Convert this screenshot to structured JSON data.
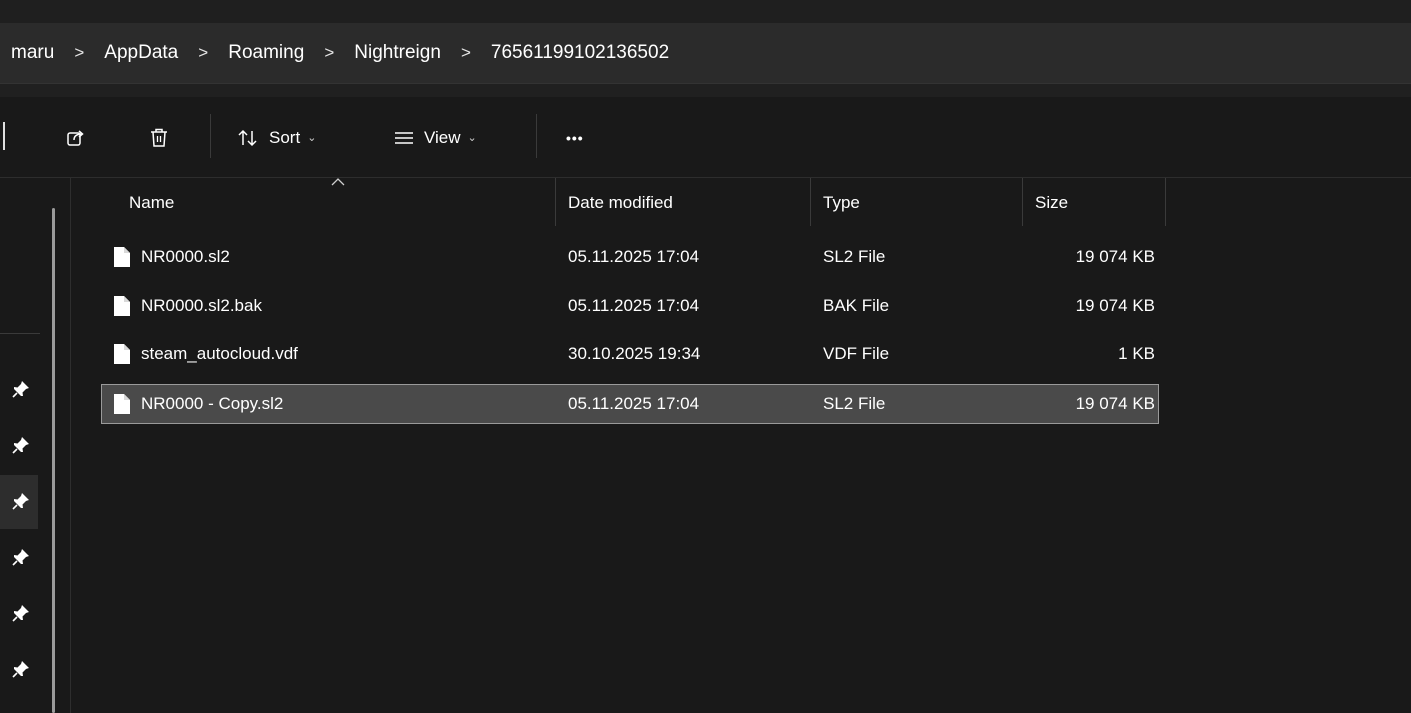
{
  "breadcrumb": {
    "items": [
      "maru",
      "AppData",
      "Roaming",
      "Nightreign",
      "76561199102136502"
    ],
    "separator": ">"
  },
  "toolbar": {
    "share_icon": "share-icon",
    "delete_icon": "trash-icon",
    "sort_label": "Sort",
    "view_label": "View",
    "more_label": "•••"
  },
  "columns": {
    "name": "Name",
    "date": "Date modified",
    "type": "Type",
    "size": "Size"
  },
  "files": [
    {
      "name": "NR0000.sl2",
      "date": "05.11.2025 17:04",
      "type": "SL2 File",
      "size": "19 074 KB"
    },
    {
      "name": "NR0000.sl2.bak",
      "date": "05.11.2025 17:04",
      "type": "BAK File",
      "size": "19 074 KB"
    },
    {
      "name": "steam_autocloud.vdf",
      "date": "30.10.2025 19:34",
      "type": "VDF File",
      "size": "1 KB"
    },
    {
      "name": "NR0000 - Copy.sl2",
      "date": "05.11.2025 17:04",
      "type": "SL2 File",
      "size": "19 074 KB"
    }
  ],
  "selected_file_index": 3,
  "colors": {
    "background": "#191919",
    "address_bar": "#2b2b2b",
    "selection": "#4a4a4a",
    "selection_border": "#9a9a9a",
    "text": "#ffffff"
  }
}
